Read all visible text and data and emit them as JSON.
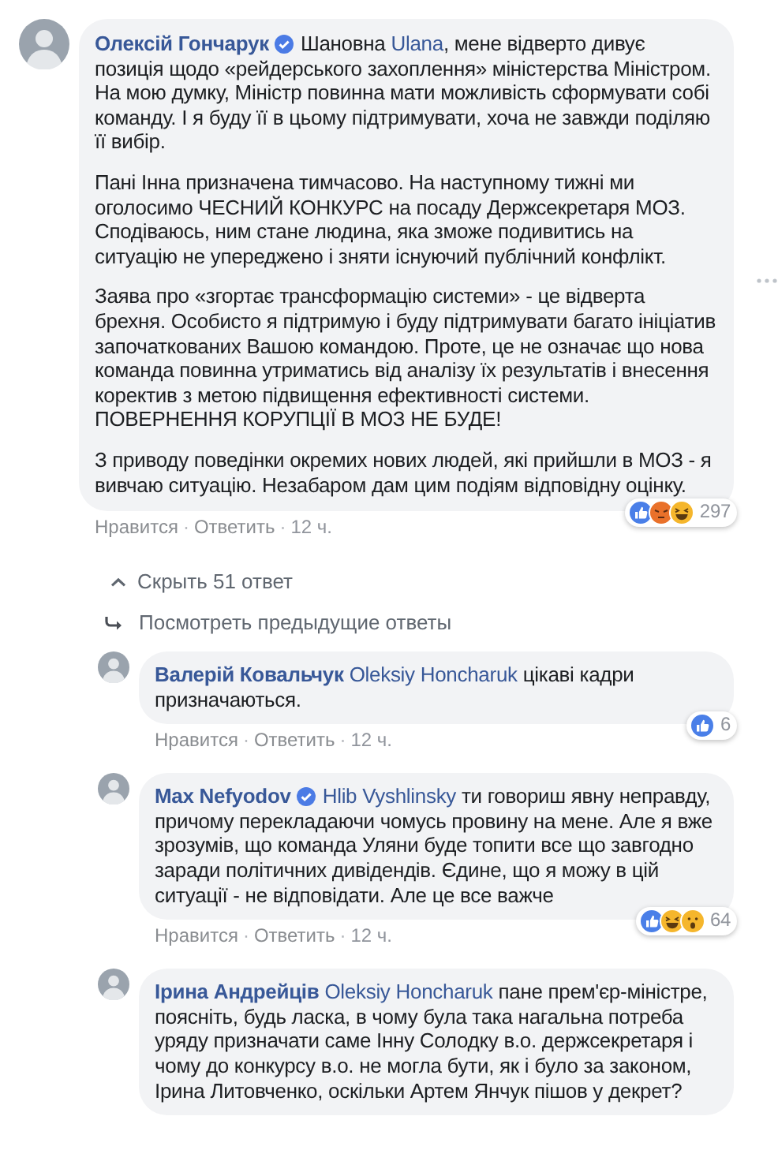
{
  "comment": {
    "author": "Олексій Гончарук",
    "verified": true,
    "paragraphs": [
      [
        {
          "kind": "text",
          "text": "Шановна "
        },
        {
          "kind": "mention",
          "text": "Ulana"
        },
        {
          "kind": "text",
          "text": ", мене відверто дивує позиція щодо «рейдерського захоплення» міністерства Міністром."
        },
        {
          "kind": "break"
        },
        {
          "kind": "text",
          "text": "На мою думку, Міністр повинна мати можливість сформувати собі команду. І я буду її в цьому підтримувати, хоча не завжди поділяю її вибір."
        }
      ],
      [
        {
          "kind": "text",
          "text": "Пані Інна призначена тимчасово. На наступному тижні ми оголосимо ЧЕСНИЙ КОНКУРС на посаду Держсекретаря МОЗ. Сподіваюсь, ним стане людина, яка зможе подивитись на ситуацію не упереджено і зняти існуючий публічний конфлікт."
        }
      ],
      [
        {
          "kind": "text",
          "text": "Заява про «згортає трансформацію системи» - це відверта брехня. Особисто я підтримую і буду підтримувати багато ініціатив започаткованих Вашою командою. Проте, це не означає що нова команда повинна утриматись від аналізу їх результатів і внесення коректив з метою підвищення ефективності системи."
        },
        {
          "kind": "break"
        },
        {
          "kind": "text",
          "text": "ПОВЕРНЕННЯ КОРУПЦІЇ В МОЗ НЕ БУДЕ!"
        }
      ],
      [
        {
          "kind": "text",
          "text": "З приводу поведінки окремих нових людей, які прийшли в МОЗ - я вивчаю ситуацію. Незабаром дам цим подіям відповідну оцінку."
        }
      ]
    ],
    "reactions": {
      "icons": [
        {
          "kind": "like"
        },
        {
          "kind": "angry"
        },
        {
          "kind": "haha"
        }
      ],
      "count": "297"
    },
    "actions": [
      {
        "kind": "link",
        "text": "Нравится"
      },
      {
        "kind": "separator",
        "text": "·"
      },
      {
        "kind": "link",
        "text": "Ответить"
      },
      {
        "kind": "separator",
        "text": "·"
      },
      {
        "kind": "time",
        "text": "12 ч."
      }
    ]
  },
  "replies_toggle": {
    "text": "Скрыть 51 ответ"
  },
  "previous_replies": {
    "text": "Посмотреть предыдущие ответы"
  },
  "replies": [
    {
      "author": "Валерій Ковальчук",
      "verified": false,
      "paragraphs": [
        [
          {
            "kind": "mention",
            "text": "Oleksiy Honcharuk"
          },
          {
            "kind": "text",
            "text": " цікаві кадри призначаються."
          }
        ]
      ],
      "reactions": {
        "icons": [
          {
            "kind": "like"
          }
        ],
        "count": "6"
      },
      "actions": [
        {
          "kind": "link",
          "text": "Нравится"
        },
        {
          "kind": "separator",
          "text": "·"
        },
        {
          "kind": "link",
          "text": "Ответить"
        },
        {
          "kind": "separator",
          "text": "·"
        },
        {
          "kind": "time",
          "text": "12 ч."
        }
      ]
    },
    {
      "author": "Max Nefyodov",
      "verified": true,
      "paragraphs": [
        [
          {
            "kind": "mention",
            "text": "Hlib Vyshlinsky"
          },
          {
            "kind": "text",
            "text": " ти говориш явну неправду, причому перекладаючи чомусь провину на мене. Але я вже зрозумів, що команда Уляни буде топити все що завгодно заради політичних дивідендів. Єдине, що я можу в цій ситуації - не відповідати. Але це все важче"
          }
        ]
      ],
      "reactions": {
        "icons": [
          {
            "kind": "like"
          },
          {
            "kind": "haha"
          },
          {
            "kind": "wow"
          }
        ],
        "count": "64"
      },
      "actions": [
        {
          "kind": "link",
          "text": "Нравится"
        },
        {
          "kind": "separator",
          "text": "·"
        },
        {
          "kind": "link",
          "text": "Ответить"
        },
        {
          "kind": "separator",
          "text": "·"
        },
        {
          "kind": "time",
          "text": "12 ч."
        }
      ]
    },
    {
      "author": "Ірина Андрейців",
      "verified": false,
      "paragraphs": [
        [
          {
            "kind": "mention",
            "text": "Oleksiy Honcharuk"
          },
          {
            "kind": "text",
            "text": " пане прем'єр-міністре, поясніть, будь ласка, в чому була така нагальна потреба уряду призначати саме Інну Солодку в.о. держсекретаря і чому до конкурсу в.о. не могла бути, як і було за законом, Ірина Литовченко, оскільки Артем Янчук пішов у декрет?"
          }
        ]
      ]
    }
  ]
}
